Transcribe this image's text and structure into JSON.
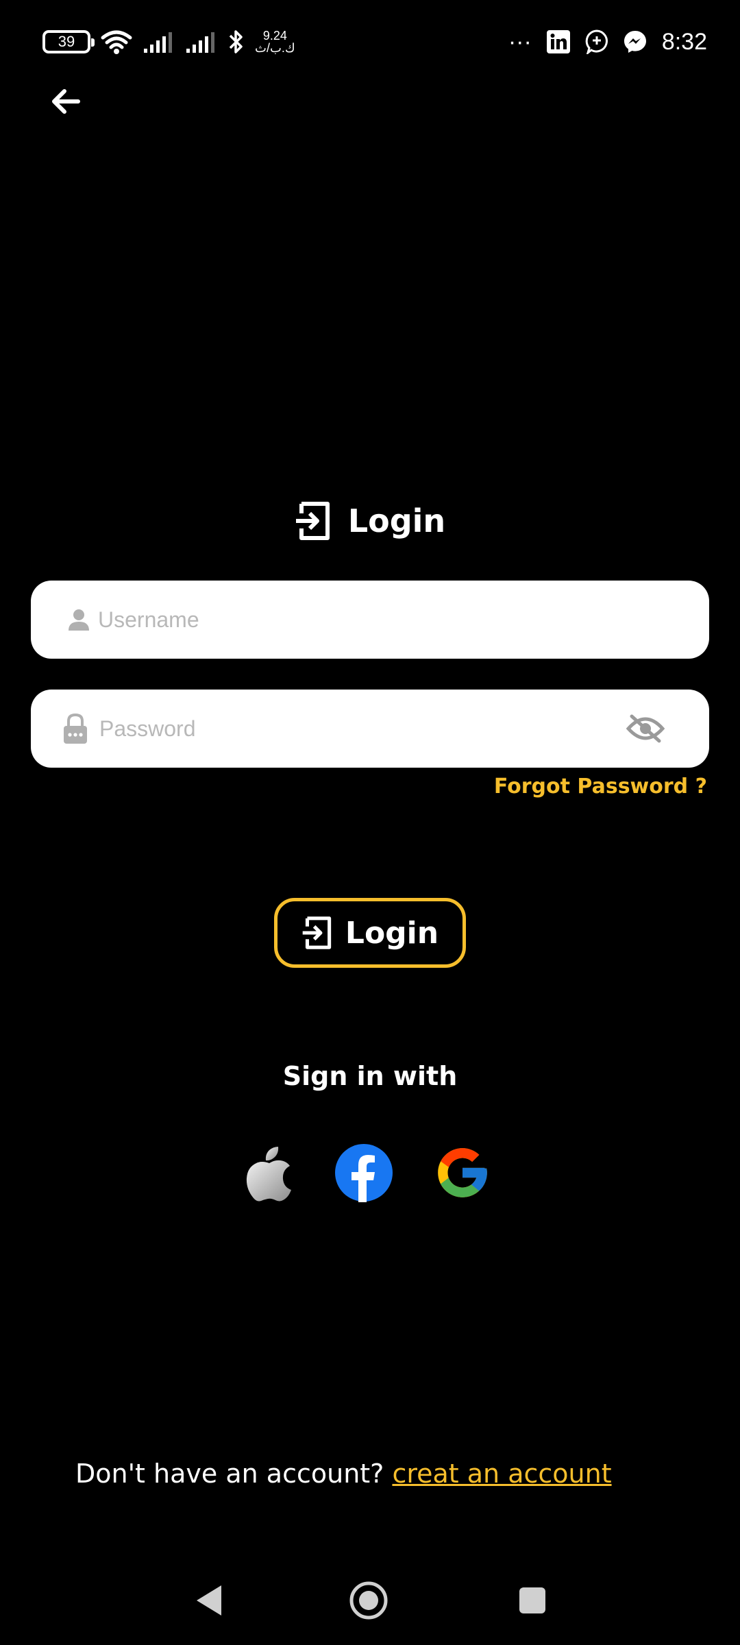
{
  "status_bar": {
    "battery": "39",
    "net_speed_value": "9.24",
    "net_speed_unit": "ك.ب/ث",
    "more": "···",
    "time": "8:32"
  },
  "heading": {
    "title": "Login"
  },
  "form": {
    "username_placeholder": "Username",
    "password_placeholder": "Password",
    "forgot_password": "Forgot Password ?",
    "login_button": "Login"
  },
  "social": {
    "label": "Sign in with",
    "providers": [
      "apple-icon",
      "facebook-icon",
      "google-icon"
    ]
  },
  "footer": {
    "prompt": "Don't have an account?",
    "link": "creat an account"
  },
  "colors": {
    "accent": "#f6be2c",
    "background": "#000000",
    "field_background": "#ffffff",
    "placeholder": "#b8b8b8",
    "facebook": "#1877f2"
  }
}
